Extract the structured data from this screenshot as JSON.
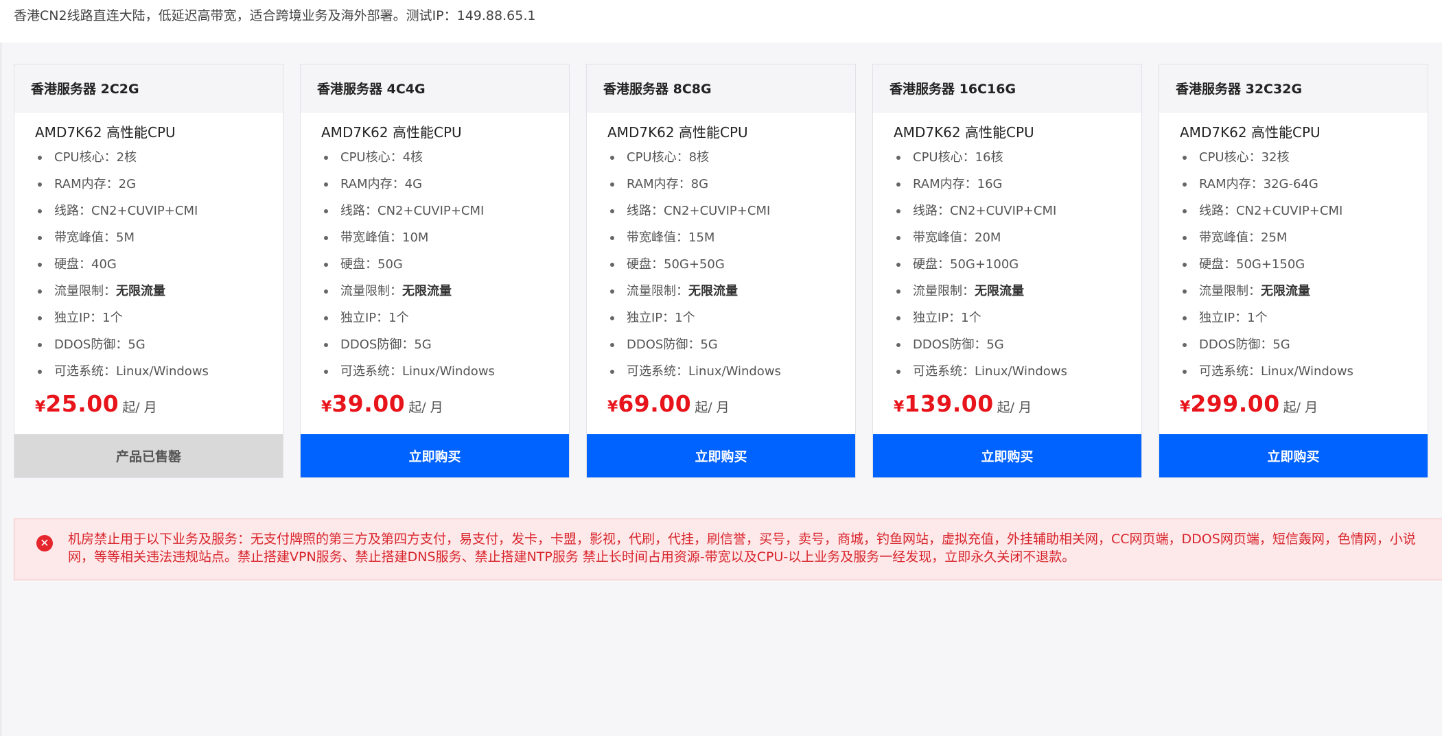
{
  "intro": "香港CN2线路直连大陆，低延迟高带宽，适合跨境业务及海外部署。测试IP：149.88.65.1",
  "currency_symbol": "¥",
  "price_unit": "起/ 月",
  "spec_labels": {
    "cpu": "CPU核心：",
    "ram": "RAM内存：",
    "line": "线路：",
    "bandwidth": "带宽峰值：",
    "disk": "硬盘：",
    "traffic": "流量限制：",
    "ip": "独立IP：",
    "ddos": "DDOS防御：",
    "os": "可选系统："
  },
  "plans": [
    {
      "title": "香港服务器 2C2G",
      "cpu_model": "AMD7K62 高性能CPU",
      "cpu": "2核",
      "ram": "2G",
      "line": "CN2+CUVIP+CMI",
      "bandwidth": "5M",
      "disk": "40G",
      "traffic": "无限流量",
      "ip": "1个",
      "ddos": "5G",
      "os": "Linux/Windows",
      "price": "25.00",
      "button": "产品已售罄",
      "status": "soldout"
    },
    {
      "title": "香港服务器 4C4G",
      "cpu_model": "AMD7K62 高性能CPU",
      "cpu": "4核",
      "ram": "4G",
      "line": "CN2+CUVIP+CMI",
      "bandwidth": "10M",
      "disk": "50G",
      "traffic": "无限流量",
      "ip": "1个",
      "ddos": "5G",
      "os": "Linux/Windows",
      "price": "39.00",
      "button": "立即购买",
      "status": "available"
    },
    {
      "title": "香港服务器 8C8G",
      "cpu_model": "AMD7K62 高性能CPU",
      "cpu": "8核",
      "ram": "8G",
      "line": "CN2+CUVIP+CMI",
      "bandwidth": "15M",
      "disk": "50G+50G",
      "traffic": "无限流量",
      "ip": "1个",
      "ddos": "5G",
      "os": "Linux/Windows",
      "price": "69.00",
      "button": "立即购买",
      "status": "available"
    },
    {
      "title": "香港服务器 16C16G",
      "cpu_model": "AMD7K62 高性能CPU",
      "cpu": "16核",
      "ram": "16G",
      "line": "CN2+CUVIP+CMI",
      "bandwidth": "20M",
      "disk": "50G+100G",
      "traffic": "无限流量",
      "ip": "1个",
      "ddos": "5G",
      "os": "Linux/Windows",
      "price": "139.00",
      "button": "立即购买",
      "status": "available"
    },
    {
      "title": "香港服务器 32C32G",
      "cpu_model": "AMD7K62 高性能CPU",
      "cpu": "32核",
      "ram": "32G-64G",
      "line": "CN2+CUVIP+CMI",
      "bandwidth": "25M",
      "disk": "50G+150G",
      "traffic": "无限流量",
      "ip": "1个",
      "ddos": "5G",
      "os": "Linux/Windows",
      "price": "299.00",
      "button": "立即购买",
      "status": "available"
    }
  ],
  "notice": {
    "icon": "error-x-icon",
    "text": "机房禁止用于以下业务及服务：无支付牌照的第三方及第四方支付，易支付，发卡，卡盟，影视，代刷，代挂，刷信誉，买号，卖号，商城，钓鱼网站，虚拟充值，外挂辅助相关网，CC网页端，DDOS网页端，短信轰网，色情网，小说网，等等相关违法违规站点。禁止搭建VPN服务、禁止搭建DNS服务、禁止搭建NTP服务 禁止长时间占用资源-带宽以及CPU-以上业务及服务一经发现，立即永久关闭不退款。"
  },
  "colors": {
    "accent_blue": "#0063ff",
    "price_red": "#e8141b",
    "soldout_gray": "#d9d9d9",
    "alert_bg": "#fde9ea",
    "alert_text": "#d8252c"
  }
}
